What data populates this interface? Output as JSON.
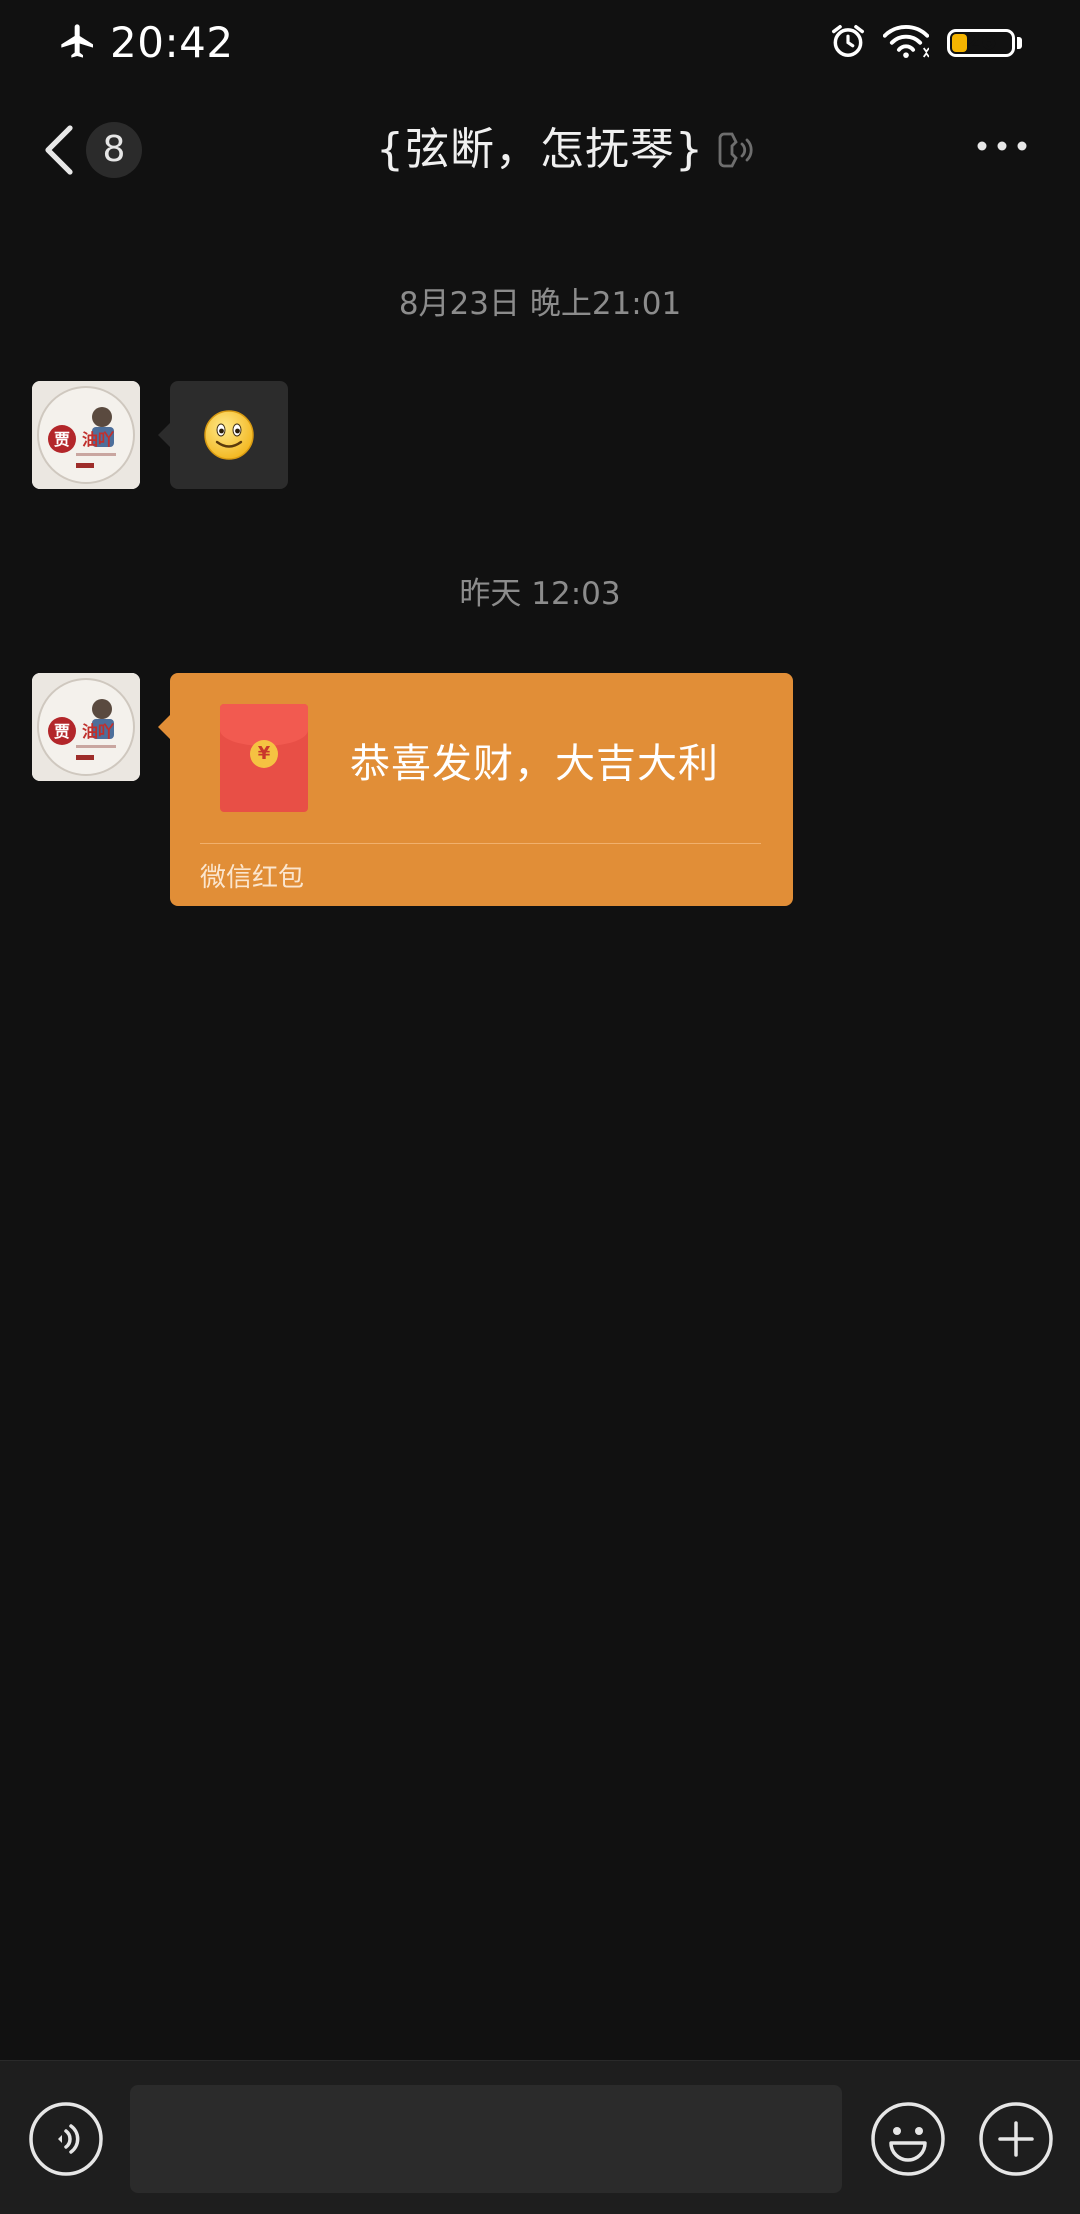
{
  "status_bar": {
    "time": "20:42",
    "battery_level": "26",
    "battery_fraction": 0.26,
    "icons": [
      "airplane-icon",
      "alarm-icon",
      "wifi-icon",
      "battery-icon"
    ]
  },
  "nav": {
    "back_badge": "8",
    "title": "{弦断，怎抚琴}",
    "icons": [
      "back-chevron-icon",
      "earpiece-icon",
      "more-dots-icon"
    ]
  },
  "messages": [
    {
      "timestamp": "8月23日 晚上21:01",
      "type": "emoji",
      "emoji": "smile-emoji"
    },
    {
      "timestamp": "昨天 12:03",
      "type": "red_packet",
      "title": "恭喜发财，大吉大利",
      "footer": "微信红包",
      "color": "#e18e37"
    }
  ],
  "input_bar": {
    "placeholder": "",
    "icons": [
      "voice-icon",
      "emoji-icon",
      "plus-icon"
    ]
  }
}
